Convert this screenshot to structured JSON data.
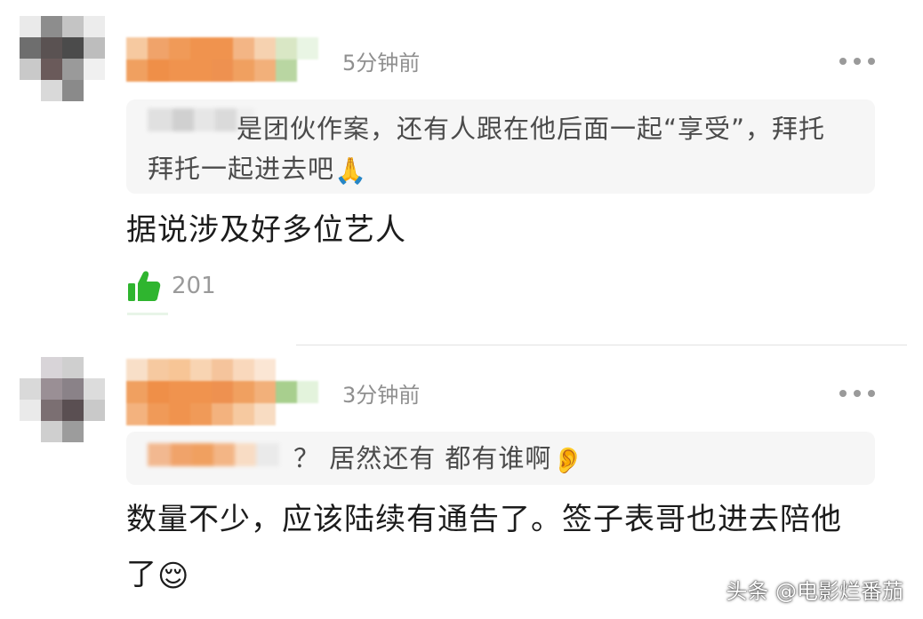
{
  "comments": [
    {
      "time": "5分钟前",
      "quote_text": "是团伙作案，还有人跟在他后面一起“享受”，拜托",
      "quote_text_line2": "拜托一起进去吧",
      "quote_emoji": "🙏",
      "body": "据说涉及好多位艺人",
      "like_count": "201"
    },
    {
      "time": "3分钟前",
      "quote_text": "？ 居然还有 都有谁啊",
      "quote_emoji": "👂",
      "body_line1": "数量不少，应该陆续有通告了。签子表哥也进去陪他",
      "body_line2": "了",
      "body_emoji": "😌"
    }
  ],
  "colors": {
    "like_green": "#2fb52f",
    "accent_orange": "#f0934e",
    "time_gray": "#8f8f8f"
  },
  "watermark": "头条 @电影烂番茄"
}
